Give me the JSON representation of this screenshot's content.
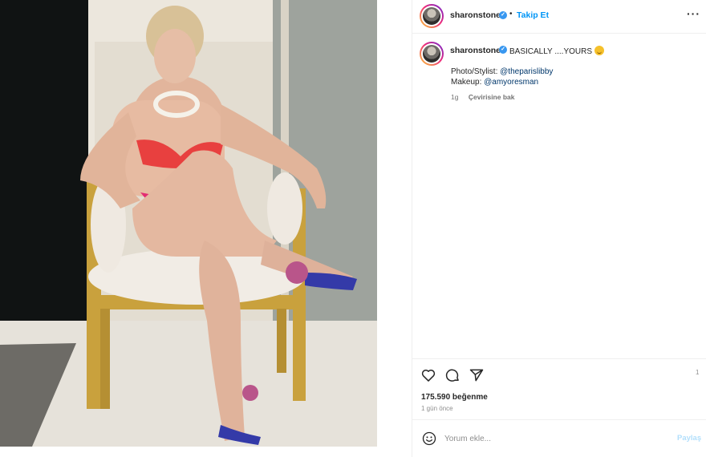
{
  "post": {
    "username": "sharonstone",
    "follow_label": "Takip Et",
    "caption": "BASICALLY ....YOURS",
    "caption_lines": [
      {
        "prefix": "Photo/Stylist: ",
        "mention": "@theparislibby"
      },
      {
        "prefix": "Makeup: ",
        "mention": "@amyoresman"
      }
    ],
    "age": "1g",
    "see_translation": "Çevirisine bak",
    "likes": "175.590 beğenme",
    "time_ago": "1 gün önce",
    "save_count_hint": "1"
  },
  "comment": {
    "placeholder": "Yorum ekle...",
    "post_label": "Paylaş"
  },
  "icons": {
    "more": "more-options-icon",
    "like": "heart-icon",
    "comment": "comment-icon",
    "share": "paper-plane-icon",
    "emoji": "smiley-icon",
    "verified": "verified-badge-icon"
  },
  "colors": {
    "link": "#0095f6",
    "mention": "#00376b",
    "verified": "#3897f0",
    "post_disabled": "#b2dffc"
  }
}
